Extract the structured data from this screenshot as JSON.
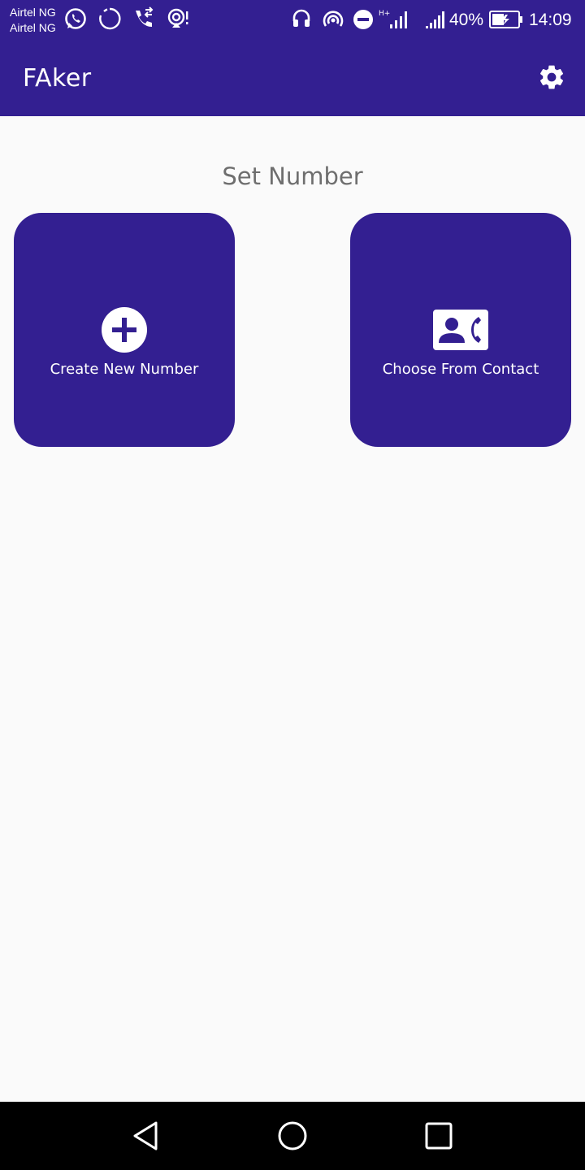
{
  "status_bar": {
    "carrier_1": "Airtel NG",
    "carrier_2": "Airtel NG",
    "battery_percent": "40%",
    "time": "14:09",
    "network_type": "H+"
  },
  "app_bar": {
    "title": "FAker",
    "settings_icon": "gear-icon"
  },
  "main": {
    "section_title": "Set Number",
    "cards": [
      {
        "label": "Create New Number",
        "icon": "add-circle-icon"
      },
      {
        "label": "Choose From Contact",
        "icon": "contact-phone-icon"
      }
    ]
  },
  "nav_bar": {
    "back_icon": "back-triangle-icon",
    "home_icon": "home-circle-icon",
    "recents_icon": "recents-square-icon"
  },
  "colors": {
    "primary": "#331f91",
    "background": "#fafafa",
    "section_text": "#6e6e6e",
    "nav_bar": "#000000"
  }
}
